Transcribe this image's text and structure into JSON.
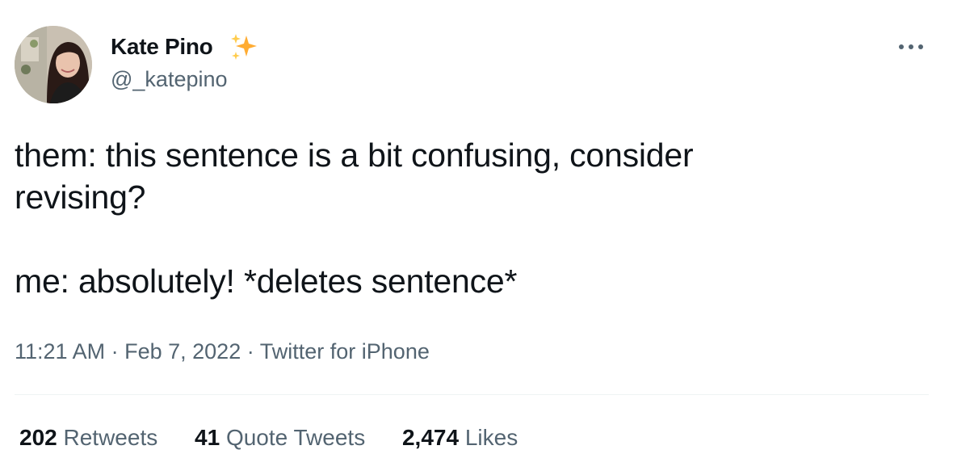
{
  "author": {
    "display_name": "Kate Pino",
    "handle": "@_katepino",
    "name_emoji": "sparkles-icon"
  },
  "tweet": {
    "line1": "them: this sentence is a bit confusing, consider",
    "line2": "revising?",
    "line3": "me: absolutely! *deletes sentence*"
  },
  "meta": {
    "time": "11:21 AM",
    "separator": "·",
    "date": "Feb 7, 2022",
    "source": "Twitter for iPhone"
  },
  "stats": {
    "retweets_count": "202",
    "retweets_label": "Retweets",
    "quotes_count": "41",
    "quotes_label": "Quote Tweets",
    "likes_count": "2,474",
    "likes_label": "Likes"
  },
  "colors": {
    "text_primary": "#0f1419",
    "text_secondary": "#536471",
    "sparkle": "#ffac33",
    "divider": "#eff3f4"
  }
}
